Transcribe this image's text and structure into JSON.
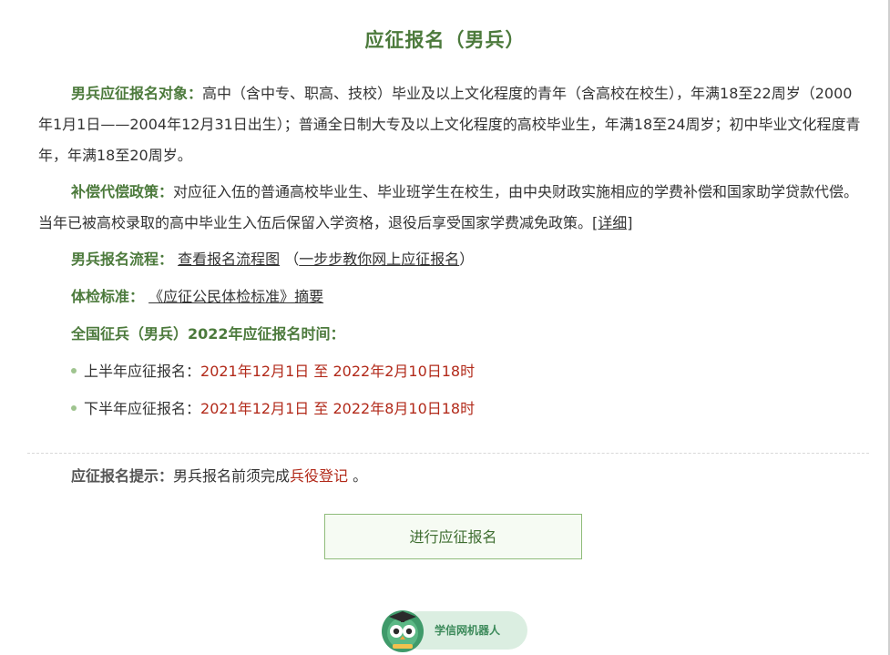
{
  "page": {
    "title": "应征报名（男兵）"
  },
  "target": {
    "label": "男兵应征报名对象：",
    "text": "高中（含中专、职高、技校）毕业及以上文化程度的青年（含高校在校生），年满18至22周岁（2000年1月1日——2004年12月31日出生）；普通全日制大专及以上文化程度的高校毕业生，年满18至24周岁；初中毕业文化程度青年，年满18至20周岁。"
  },
  "compensation": {
    "label": "补偿代偿政策：",
    "text": "对应征入伍的普通高校毕业生、毕业班学生在校生，由中央财政实施相应的学费补偿和国家助学贷款代偿。当年已被高校录取的高中毕业生入伍后保留入学资格，退役后享受国家学费减免政策。",
    "detail_link": "[详细]"
  },
  "process": {
    "label": "男兵报名流程：",
    "flowchart_link": "查看报名流程图",
    "paren_open": "（",
    "tutorial_link": "一步步教你网上应征报名",
    "paren_close": "）"
  },
  "physical": {
    "label": "体检标准：",
    "link": "《应征公民体检标准》摘要"
  },
  "schedule": {
    "label": "全国征兵（男兵）2022年应征报名时间：",
    "items": [
      {
        "label": "上半年应征报名：",
        "start": "2021年12月1日",
        "sep": "至",
        "end": "2022年2月10日18时"
      },
      {
        "label": "下半年应征报名：",
        "start": "2021年12月1日",
        "sep": "至",
        "end": "2022年8月10日18时"
      }
    ]
  },
  "tip": {
    "label": "应征报名提示：",
    "text": "男兵报名前须完成",
    "link": "兵役登记",
    "suffix": " 。"
  },
  "apply_button": {
    "label": "进行应征报名"
  },
  "robot": {
    "label": "学信网机器人"
  },
  "colors": {
    "accent_green": "#4c7a3c",
    "date_red": "#b22a1a",
    "button_border": "#8fbc7a"
  }
}
